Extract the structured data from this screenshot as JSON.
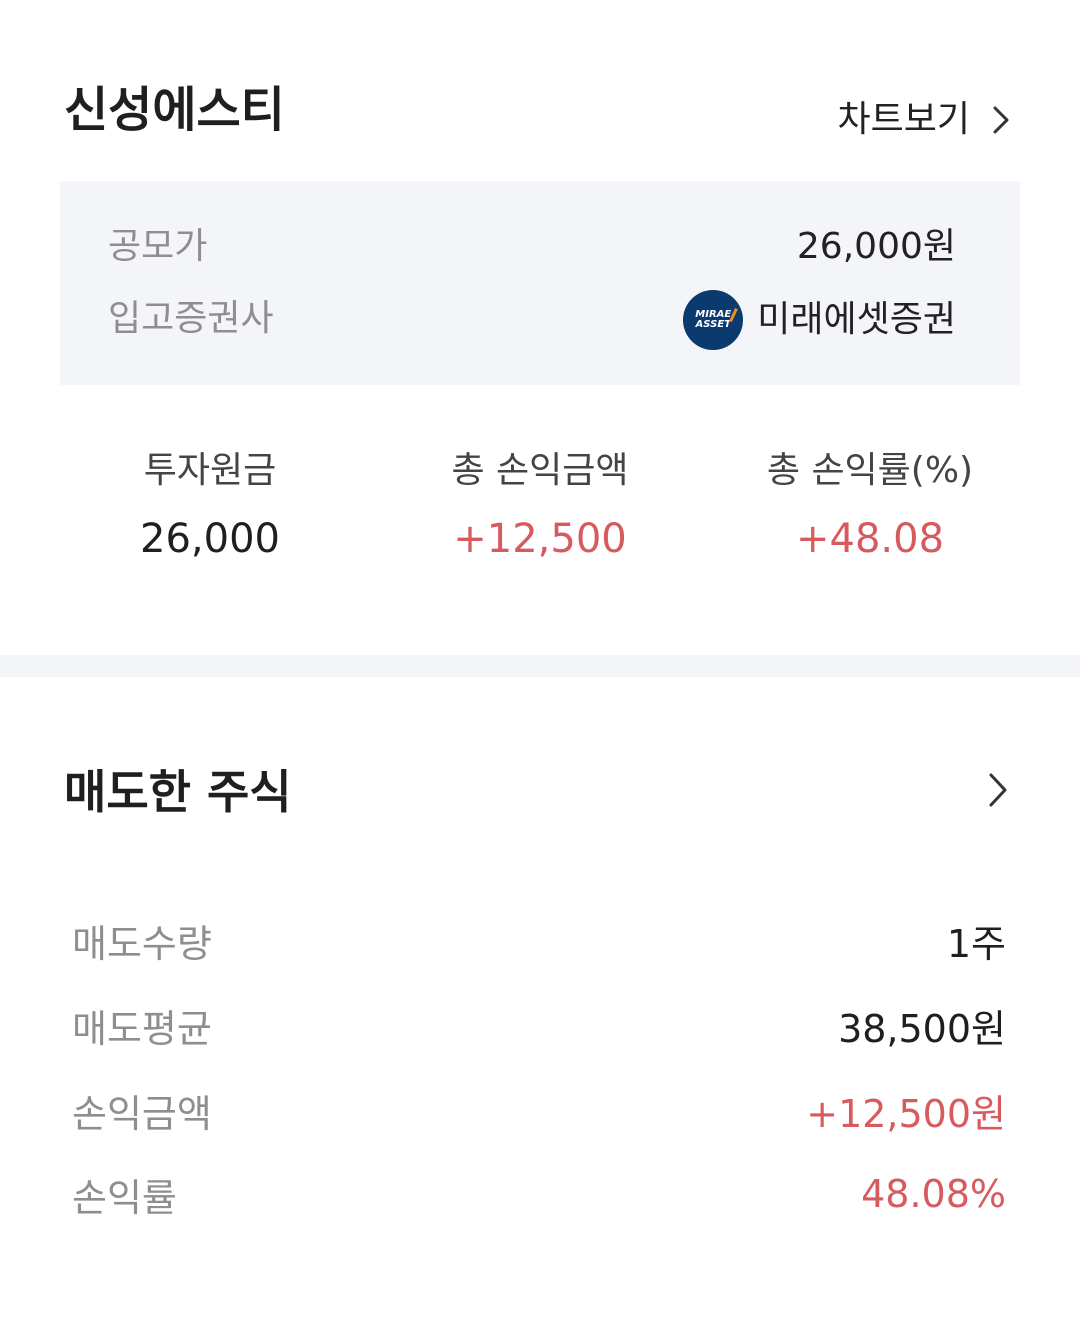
{
  "header": {
    "stock_name": "신성에스티",
    "chart_link_label": "차트보기"
  },
  "info": {
    "offer_price_label": "공모가",
    "offer_price_value": "26,000원",
    "broker_label": "입고증권사",
    "broker_name": "미래에셋증권",
    "broker_logo_line1": "MIRAE",
    "broker_logo_line2": "ASSET"
  },
  "summary": [
    {
      "label": "투자원금",
      "value": "26,000"
    },
    {
      "label": "총 손익금액",
      "value": "+12,500"
    },
    {
      "label": "총 손익률(%)",
      "value": "+48.08"
    }
  ],
  "sold": {
    "title": "매도한 주식",
    "rows": [
      {
        "label": "매도수량",
        "value": "1주"
      },
      {
        "label": "매도평균",
        "value": "38,500원"
      },
      {
        "label": "손익금액",
        "value": "+12,500원"
      },
      {
        "label": "손익률",
        "value": "48.08%"
      }
    ]
  },
  "colors": {
    "profit_red": "#d75a5e",
    "panel_bg": "#f4f5f8",
    "broker_navy": "#0b3a6e"
  }
}
